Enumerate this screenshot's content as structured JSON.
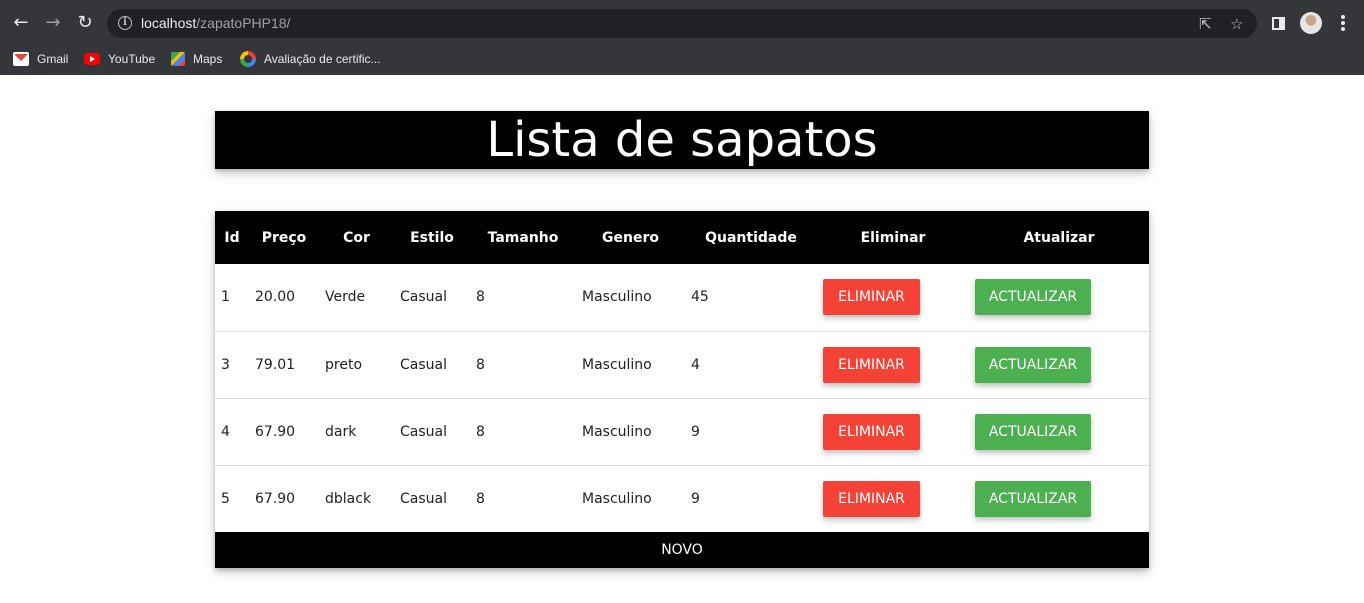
{
  "browser": {
    "url_host": "localhost",
    "url_path": "/zapatoPHP18/",
    "bookmarks": [
      {
        "label": "Gmail",
        "icon": "gmail-icon"
      },
      {
        "label": "YouTube",
        "icon": "youtube-icon"
      },
      {
        "label": "Maps",
        "icon": "maps-icon"
      },
      {
        "label": "Avaliação de certific...",
        "icon": "google-icon"
      }
    ]
  },
  "page": {
    "title": "Lista de sapatos",
    "columns": [
      "Id",
      "Preço",
      "Cor",
      "Estilo",
      "Tamanho",
      "Genero",
      "Quantidade",
      "Eliminar",
      "Atualizar"
    ],
    "rows": [
      {
        "id": "1",
        "preco": "20.00",
        "cor": "Verde",
        "estilo": "Casual",
        "tamanho": "8",
        "genero": "Masculino",
        "quantidade": "45"
      },
      {
        "id": "3",
        "preco": "79.01",
        "cor": "preto",
        "estilo": "Casual",
        "tamanho": "8",
        "genero": "Masculino",
        "quantidade": "4"
      },
      {
        "id": "4",
        "preco": "67.90",
        "cor": "dark",
        "estilo": "Casual",
        "tamanho": "8",
        "genero": "Masculino",
        "quantidade": "9"
      },
      {
        "id": "5",
        "preco": "67.90",
        "cor": "dblack",
        "estilo": "Casual",
        "tamanho": "8",
        "genero": "Masculino",
        "quantidade": "9"
      }
    ],
    "delete_label": "ELIMINAR",
    "update_label": "ACTUALIZAR",
    "new_label": "NOVO"
  },
  "colors": {
    "delete": "#f44336",
    "update": "#4caf50",
    "header_bg": "#000000"
  }
}
